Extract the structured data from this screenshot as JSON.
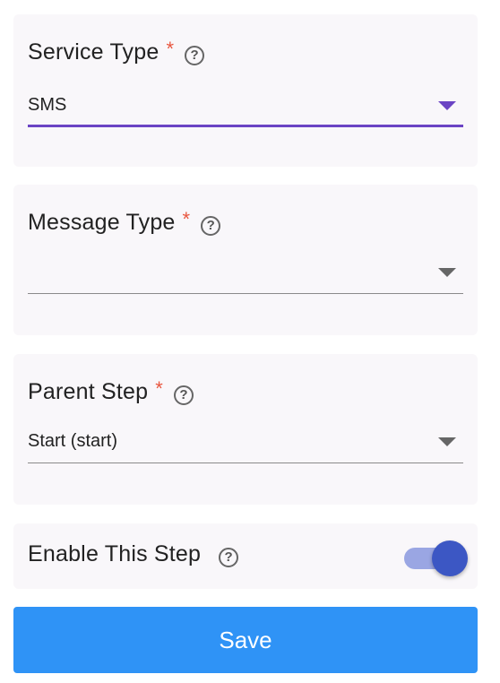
{
  "colors": {
    "accent": "#6b44c4",
    "required": "#e8563f",
    "save_button": "#2f93f6",
    "toggle_thumb": "#3c57c4",
    "toggle_track": "#9aa6e3"
  },
  "form": {
    "service_type": {
      "label": "Service Type",
      "required_mark": "*",
      "help_icon": "question-circle-icon",
      "help_glyph": "?",
      "value": "SMS"
    },
    "message_type": {
      "label": "Message Type",
      "required_mark": "*",
      "help_icon": "question-circle-icon",
      "help_glyph": "?",
      "value": ""
    },
    "parent_step": {
      "label": "Parent Step",
      "required_mark": "*",
      "help_icon": "question-circle-icon",
      "help_glyph": "?",
      "value": "Start (start)"
    },
    "enable_step": {
      "label": "Enable This Step",
      "help_icon": "question-circle-icon",
      "help_glyph": "?",
      "enabled": true
    }
  },
  "actions": {
    "save_label": "Save"
  }
}
